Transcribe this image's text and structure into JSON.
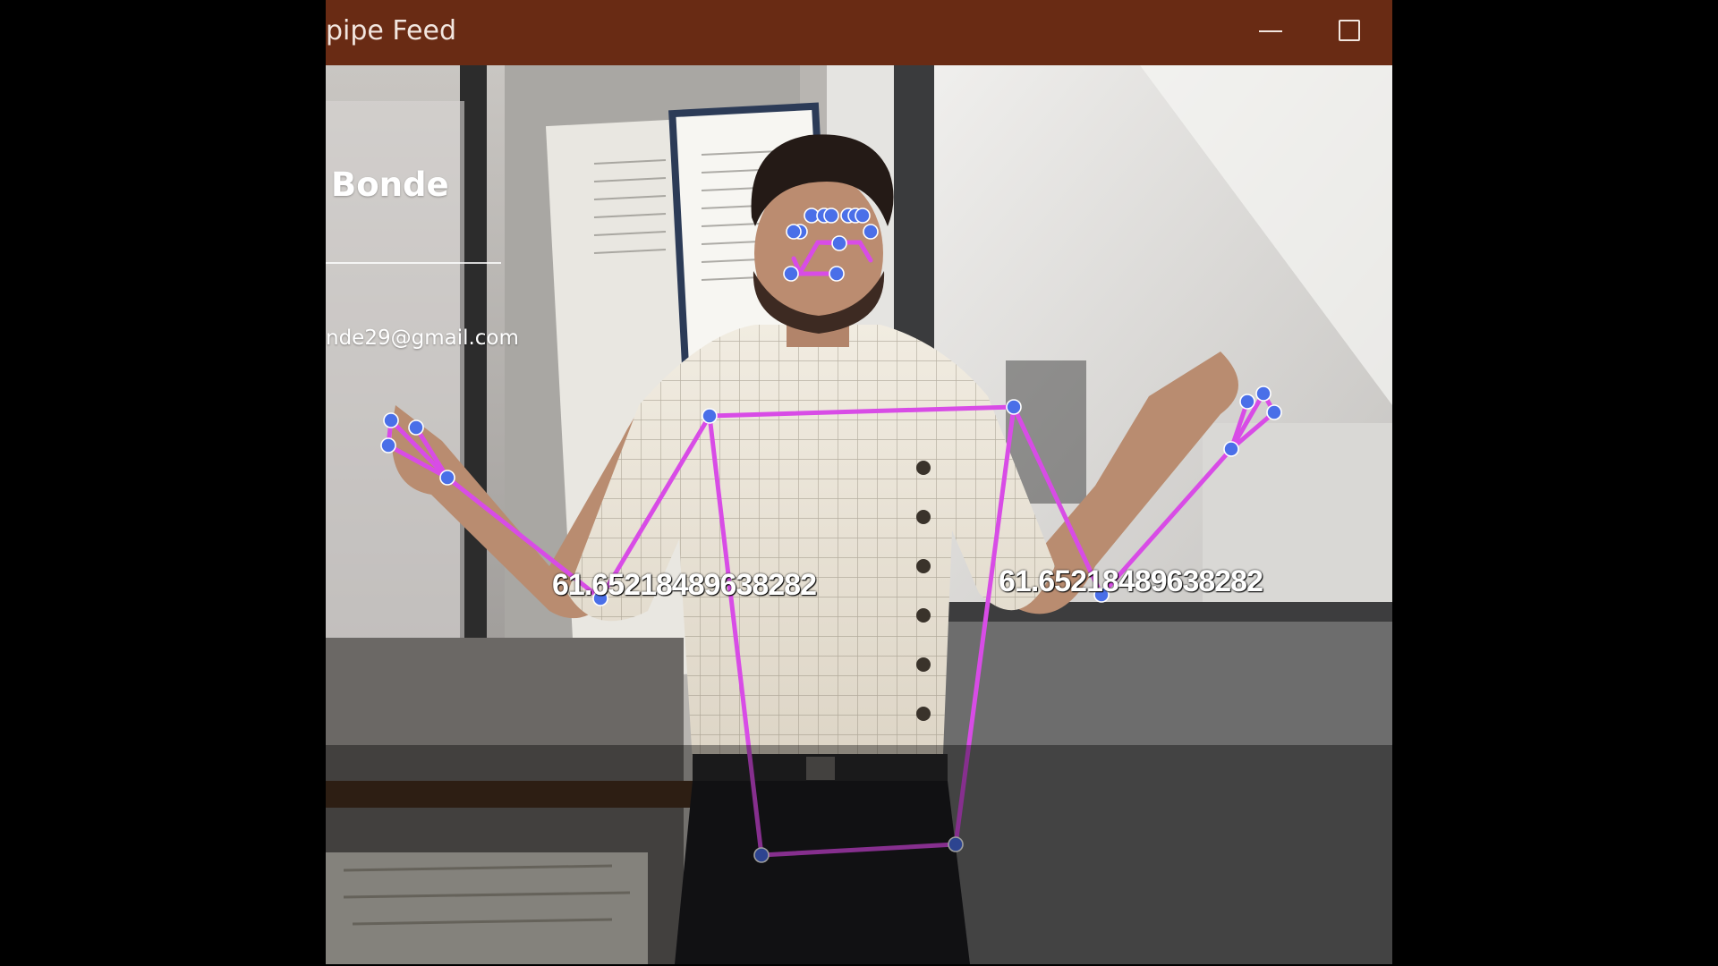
{
  "window": {
    "title": "pipe Feed"
  },
  "overlay": {
    "name": "Bonde",
    "email": "nde29@gmail.com"
  },
  "angles": {
    "left_elbow": "61.65218489638282",
    "right_elbow": "61.65218489638282"
  },
  "colors": {
    "titlebar": "#692b14",
    "skeleton_line": "#d84ce6",
    "landmark_dot": "#4a6fe8",
    "landmark_outline": "#ffffff"
  },
  "icons": {
    "minimize": "minimize-icon",
    "maximize": "maximize-icon"
  }
}
